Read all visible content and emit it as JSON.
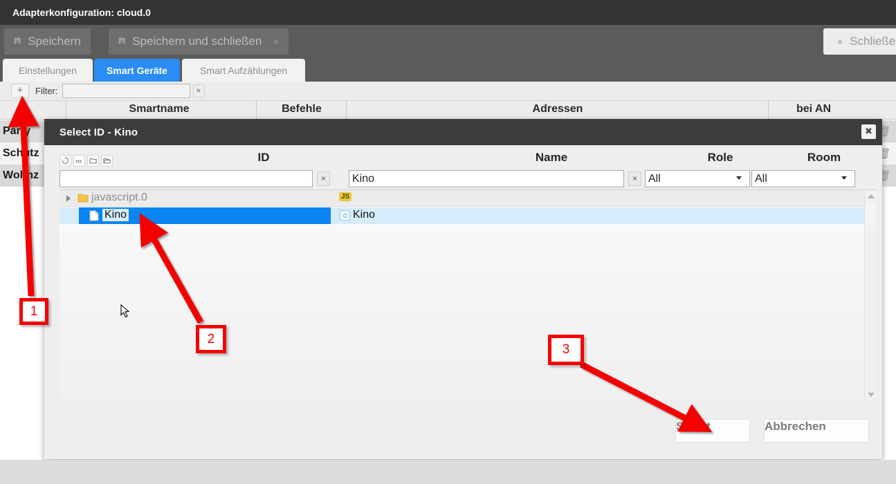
{
  "window": {
    "title": "Adapterkonfiguration: cloud.0"
  },
  "toolbar": {
    "save_label": "Speichern",
    "save_icon": "floppy-icon",
    "save_close_label": "Speichern und schließen",
    "save_close_icon": "floppy-icon",
    "save_close_x": "×",
    "close_label": "Schließen",
    "close_x": "×"
  },
  "tabs": [
    {
      "label": "Einstellungen",
      "active": false
    },
    {
      "label": "Smart Geräte",
      "active": true
    },
    {
      "label": "Smart Aufzählungen",
      "active": false
    }
  ],
  "filter": {
    "add_label": "+",
    "label": "Filter:",
    "value": "",
    "placeholder": "",
    "clear_label": "×"
  },
  "bg_table": {
    "columns": [
      "Smartname",
      "Befehle",
      "Adressen",
      "bei AN"
    ],
    "rows": [
      {
        "smartname": "Party",
        "delete_icon": "trash-icon"
      },
      {
        "smartname": "Schutz",
        "delete_icon": "trash-icon"
      },
      {
        "smartname": "Wohnz",
        "delete_icon": "trash-icon"
      }
    ]
  },
  "dialog": {
    "title": "Select ID - Kino",
    "close_label": "✖",
    "tools": [
      "refresh-icon",
      "grid-icon",
      "folder-closed-icon",
      "folder-open-icon"
    ],
    "columns": [
      "ID",
      "Name",
      "Role",
      "Room"
    ],
    "filters": {
      "id_value": "",
      "id_placeholder": "",
      "id_clear": "×",
      "name_value": "Kino",
      "name_placeholder": "",
      "name_clear": "×",
      "role_value": "All",
      "room_value": "All"
    },
    "tree": [
      {
        "type": "folder",
        "id": "javascript.0",
        "icon": "folder-icon",
        "expander": "chevron-right-icon",
        "badge": "JS",
        "expanded": true
      },
      {
        "type": "state",
        "id": "Kino",
        "icon": "document-icon",
        "name": "Kino",
        "name_icon": "state-icon",
        "selected": true
      }
    ],
    "scrollbar": {
      "up": "scroll-up-arrow",
      "down": "scroll-down-arrow"
    },
    "buttons": {
      "select": "Select",
      "cancel": "Abbrechen"
    }
  },
  "annotations": [
    {
      "id": "1",
      "label": "1"
    },
    {
      "id": "2",
      "label": "2"
    },
    {
      "id": "3",
      "label": "3"
    }
  ],
  "colors": {
    "accent": "#2a8cf4",
    "selection": "#0a84f0",
    "annotation": "#f40000",
    "titlebar": "#333333",
    "toolbar": "#5b5b5b",
    "dialog_header": "#3c3c3c"
  }
}
